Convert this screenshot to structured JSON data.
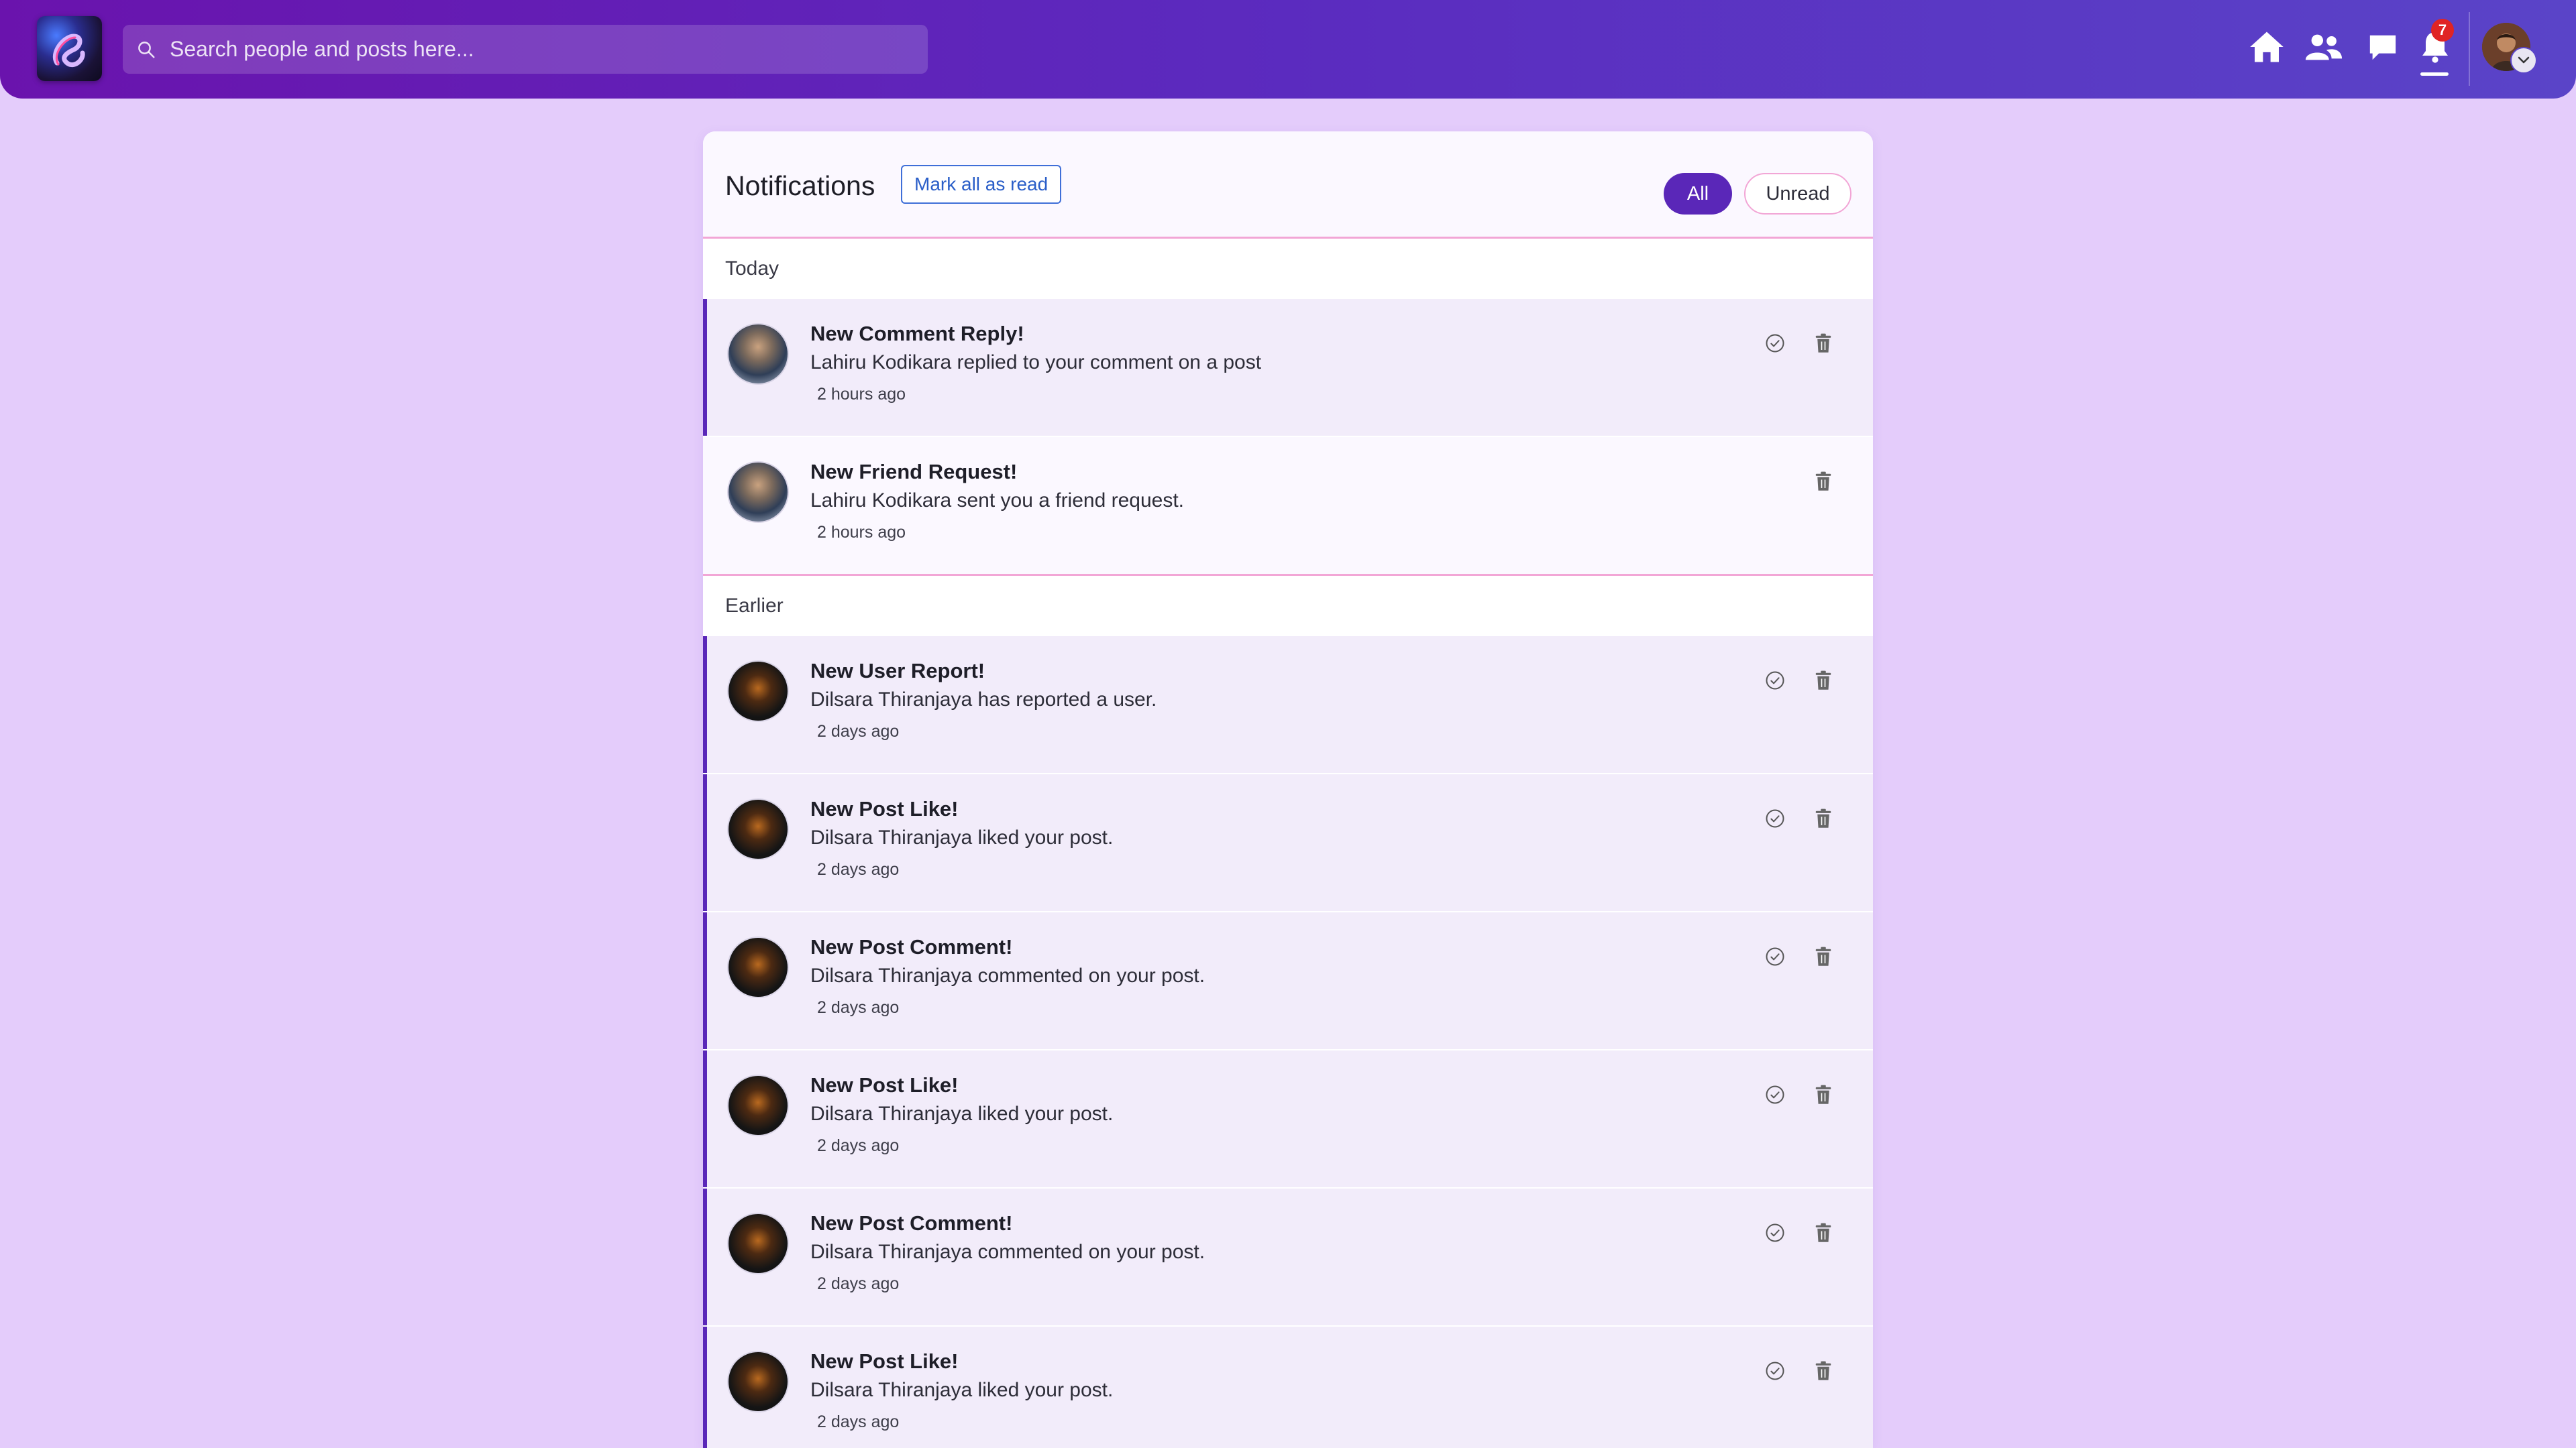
{
  "header": {
    "search_placeholder": "Search people and posts here...",
    "notification_count": "7",
    "icons": [
      "home-icon",
      "friends-icon",
      "messages-icon",
      "bell-icon"
    ]
  },
  "panel": {
    "title": "Notifications",
    "mark_all_label": "Mark all as read",
    "filter_all": "All",
    "filter_unread": "Unread"
  },
  "sections": [
    {
      "label": "Today",
      "items": [
        {
          "title": "New Comment Reply!",
          "text": "Lahiru Kodikara replied to your comment on a post",
          "time": "2 hours ago",
          "unread": true
        },
        {
          "title": "New Friend Request!",
          "text": "Lahiru Kodikara sent you a friend request.",
          "time": "2 hours ago",
          "unread": false
        }
      ]
    },
    {
      "label": "Earlier",
      "items": [
        {
          "title": "New User Report!",
          "text": "Dilsara Thiranjaya has reported a user.",
          "time": "2 days ago",
          "unread": true
        },
        {
          "title": "New Post Like!",
          "text": "Dilsara Thiranjaya liked your post.",
          "time": "2 days ago",
          "unread": true
        },
        {
          "title": "New Post Comment!",
          "text": "Dilsara Thiranjaya commented on your post.",
          "time": "2 days ago",
          "unread": true
        },
        {
          "title": "New Post Like!",
          "text": "Dilsara Thiranjaya liked your post.",
          "time": "2 days ago",
          "unread": true
        },
        {
          "title": "New Post Comment!",
          "text": "Dilsara Thiranjaya commented on your post.",
          "time": "2 days ago",
          "unread": true
        },
        {
          "title": "New Post Like!",
          "text": "Dilsara Thiranjaya liked your post.",
          "time": "2 days ago",
          "unread": true
        }
      ]
    }
  ],
  "colors": {
    "accent": "#5a27b8",
    "divider": "#f2a6d6",
    "badge": "#e02424",
    "page_bg": "#e4ccfb"
  }
}
